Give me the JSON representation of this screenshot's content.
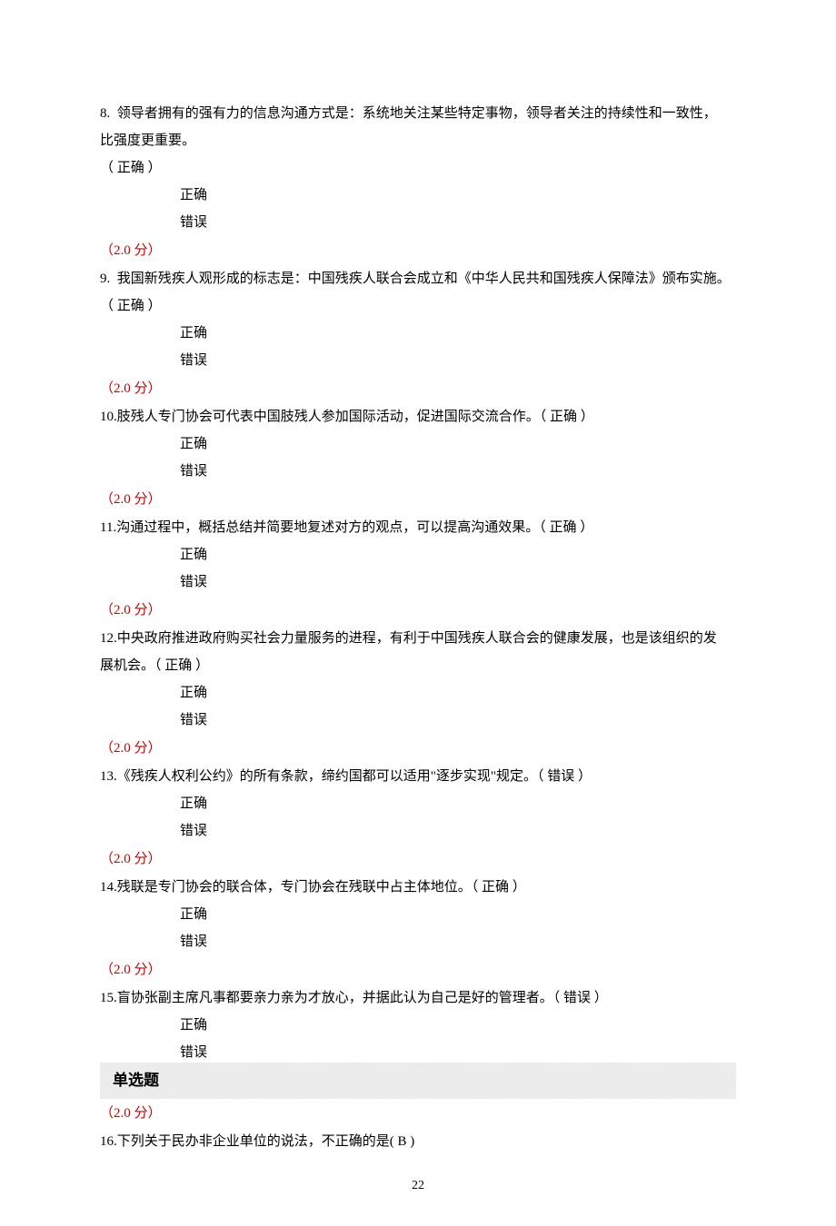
{
  "q8": {
    "num": "8.",
    "text": "领导者拥有的强有力的信息沟通方式是：系统地关注某些特定事物，领导者关注的持续性和一致性，",
    "text2": "比强度更重要。",
    "answer_line": "（   正确  ）",
    "opt_true": "正确",
    "opt_false": "错误",
    "points": "（2.0 分）"
  },
  "q9": {
    "num": "9.",
    "text": "我国新残疾人观形成的标志是：中国残疾人联合会成立和《中华人民共和国残疾人保障法》颁布实施。",
    "answer_line": "（   正确   ）",
    "opt_true": "正确",
    "opt_false": "错误",
    "points": "（2.0 分）"
  },
  "q10": {
    "num": "10.",
    "text": "肢残人专门协会可代表中国肢残人参加国际活动，促进国际交流合作。（   正确   ）",
    "opt_true": "正确",
    "opt_false": "错误",
    "points": "（2.0 分）"
  },
  "q11": {
    "num": "11.",
    "text": "沟通过程中，概括总结并简要地复述对方的观点，可以提高沟通效果。（   正确   ）",
    "opt_true": "正确",
    "opt_false": "错误",
    "points": "（2.0 分）"
  },
  "q12": {
    "num": "12.",
    "text": "中央政府推进政府购买社会力量服务的进程，有利于中国残疾人联合会的健康发展，也是该组织的发",
    "text2": "展机会。（ 正确    ）",
    "opt_true": "正确",
    "opt_false": "错误",
    "points": "（2.0 分）"
  },
  "q13": {
    "num": "13.",
    "text": "《残疾人权利公约》的所有条款，缔约国都可以适用\"逐步实现\"规定。（   错误   ）",
    "opt_true": "正确",
    "opt_false": "错误",
    "points": "（2.0 分）"
  },
  "q14": {
    "num": "14.",
    "text": "残联是专门协会的联合体，专门协会在残联中占主体地位。（   正确   ）",
    "opt_true": "正确",
    "opt_false": "错误",
    "points": "（2.0 分）"
  },
  "q15": {
    "num": "15.",
    "text": "盲协张副主席凡事都要亲力亲为才放心，并据此认为自己是好的管理者。（ 错误    ）",
    "opt_true": "正确",
    "opt_false": "错误"
  },
  "section": {
    "heading": "单选题"
  },
  "q16": {
    "points": "（2.0 分）",
    "num": "16.",
    "text": "下列关于民办非企业单位的说法，不正确的是(   B   )"
  },
  "page_number": "22"
}
